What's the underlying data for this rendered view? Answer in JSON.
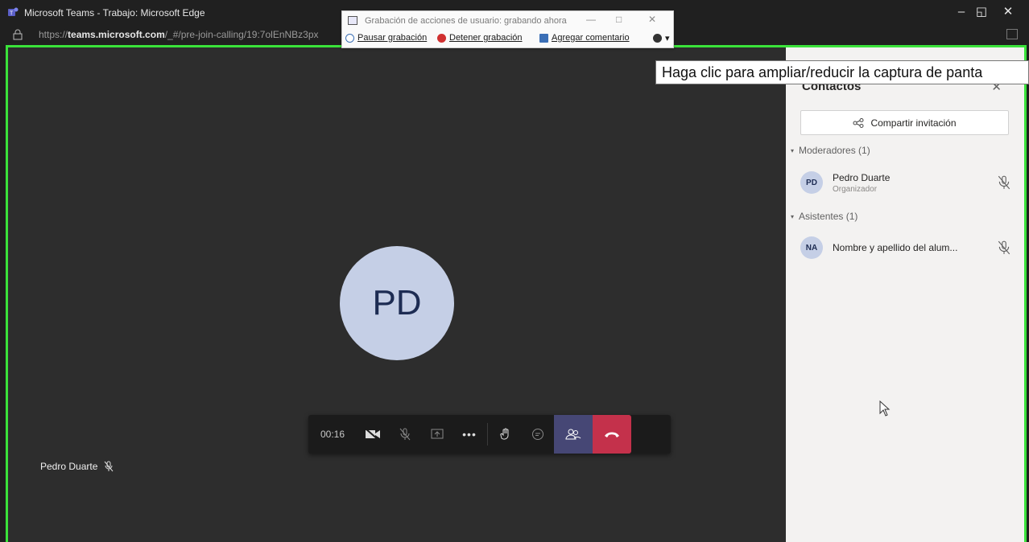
{
  "window": {
    "title": "Microsoft Teams - Trabajo: Microsoft Edge",
    "url_prefix": "https://",
    "url_domain": "teams.microsoft.com",
    "url_path": "/_#/pre-join-calling/19:7olEnNBz3px"
  },
  "recorder": {
    "title": "Grabación de acciones de usuario: grabando ahora",
    "pause_label": "Pausar grabación",
    "stop_label": "Detener grabación",
    "comment_label": "Agregar comentario"
  },
  "tooltip": "Haga clic para ampliar/reducir la captura de panta",
  "stage": {
    "avatar_initials": "PD",
    "participant_name": "Pedro Duarte"
  },
  "controls": {
    "timer": "00:16"
  },
  "panel": {
    "title": "Contactos",
    "share_label": "Compartir invitación",
    "moderators_label": "Moderadores (1)",
    "attendees_label": "Asistentes (1)",
    "moderators": [
      {
        "initials": "PD",
        "name": "Pedro Duarte",
        "role": "Organizador"
      }
    ],
    "attendees": [
      {
        "initials": "NA",
        "name": "Nombre y apellido del alum..."
      }
    ]
  },
  "colors": {
    "capture_border": "#3ae33a",
    "hangup": "#c4314b",
    "people_active": "#464775",
    "avatar_bg": "#c5cfe6"
  }
}
